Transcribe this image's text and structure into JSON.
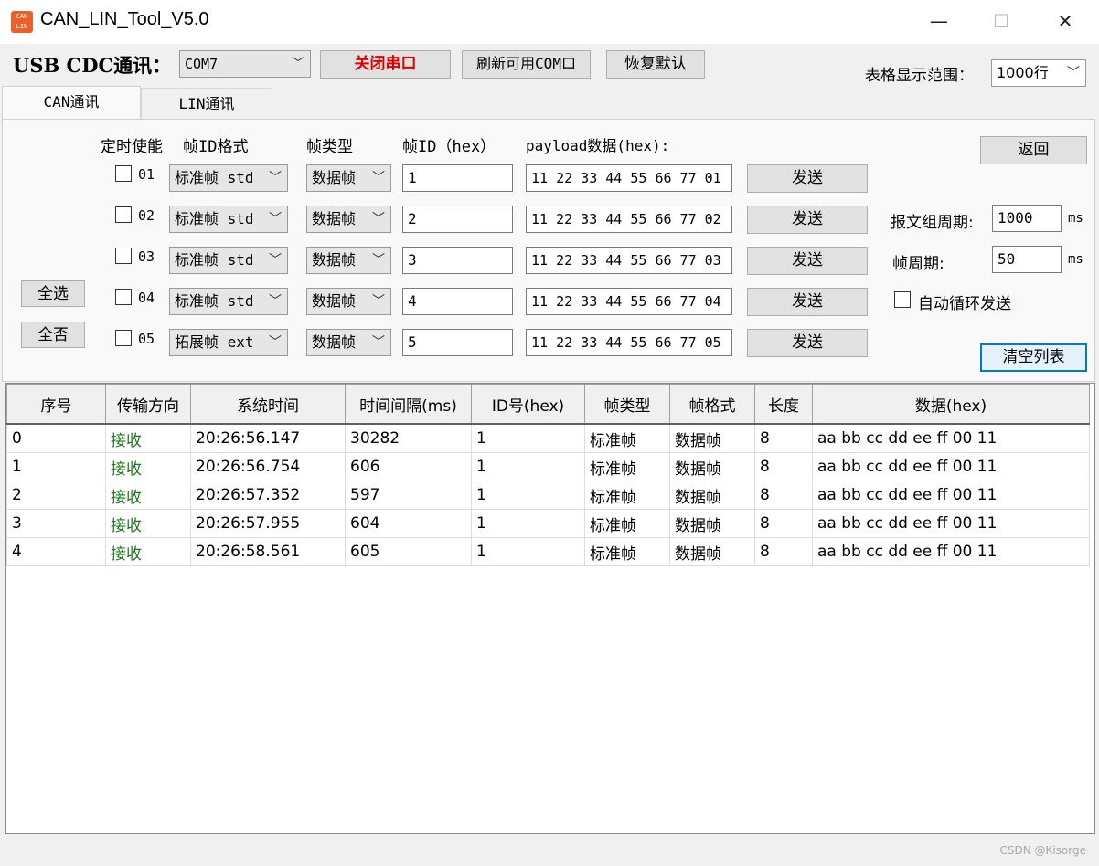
{
  "window": {
    "title": "CAN_LIN_Tool_V5.0",
    "icon_text_top": "CAN",
    "icon_text_bottom": "LIN",
    "minimize": "—",
    "maximize": "☐",
    "close": "✕"
  },
  "toolbar": {
    "usb_label": "USB CDC通讯：",
    "com_port": "COM7",
    "close_port_label": "关闭串口",
    "refresh_label": "刷新可用COM口",
    "restore_label": "恢复默认",
    "range_label": "表格显示范围：",
    "range_value": "1000行"
  },
  "tabs": [
    {
      "label": "CAN通讯",
      "active": true
    },
    {
      "label": "LIN通讯",
      "active": false
    }
  ],
  "can": {
    "headers": {
      "enable": "定时使能",
      "id_format": "帧ID格式",
      "frame_type": "帧类型",
      "frame_id": "帧ID（hex）",
      "payload": "payload数据(hex):"
    },
    "rows": [
      {
        "num": "01",
        "checked": false,
        "id_format": "标准帧 std",
        "frame_type": "数据帧",
        "frame_id": "1",
        "payload": "11 22 33 44 55 66 77 01",
        "send": "发送"
      },
      {
        "num": "02",
        "checked": false,
        "id_format": "标准帧 std",
        "frame_type": "数据帧",
        "frame_id": "2",
        "payload": "11 22 33 44 55 66 77 02",
        "send": "发送"
      },
      {
        "num": "03",
        "checked": false,
        "id_format": "标准帧 std",
        "frame_type": "数据帧",
        "frame_id": "3",
        "payload": "11 22 33 44 55 66 77 03",
        "send": "发送"
      },
      {
        "num": "04",
        "checked": false,
        "id_format": "标准帧 std",
        "frame_type": "数据帧",
        "frame_id": "4",
        "payload": "11 22 33 44 55 66 77 04",
        "send": "发送"
      },
      {
        "num": "05",
        "checked": false,
        "id_format": "拓展帧 ext",
        "frame_type": "数据帧",
        "frame_id": "5",
        "payload": "11 22 33 44 55 66 77 05",
        "send": "发送"
      }
    ],
    "select_all": "全选",
    "select_none": "全否",
    "back": "返回",
    "group_period_label": "报文组周期:",
    "group_period_value": "1000",
    "group_period_unit": "ms",
    "frame_period_label": "帧周期:",
    "frame_period_value": "50",
    "frame_period_unit": "ms",
    "auto_loop_label": "自动循环发送",
    "clear_list": "清空列表"
  },
  "grid": {
    "columns": [
      "序号",
      "传输方向",
      "系统时间",
      "时间间隔(ms)",
      "ID号(hex)",
      "帧类型",
      "帧格式",
      "长度",
      "数据(hex)"
    ],
    "rows": [
      [
        "0",
        "接收",
        "20:26:56.147",
        "30282",
        "1",
        "标准帧",
        "数据帧",
        "8",
        "aa bb cc dd ee ff 00 11"
      ],
      [
        "1",
        "接收",
        "20:26:56.754",
        "606",
        "1",
        "标准帧",
        "数据帧",
        "8",
        "aa bb cc dd ee ff 00 11"
      ],
      [
        "2",
        "接收",
        "20:26:57.352",
        "597",
        "1",
        "标准帧",
        "数据帧",
        "8",
        "aa bb cc dd ee ff 00 11"
      ],
      [
        "3",
        "接收",
        "20:26:57.955",
        "604",
        "1",
        "标准帧",
        "数据帧",
        "8",
        "aa bb cc dd ee ff 00 11"
      ],
      [
        "4",
        "接收",
        "20:26:58.561",
        "605",
        "1",
        "标准帧",
        "数据帧",
        "8",
        "aa bb cc dd ee ff 00 11"
      ]
    ]
  },
  "watermark": "CSDN @Kisorge"
}
